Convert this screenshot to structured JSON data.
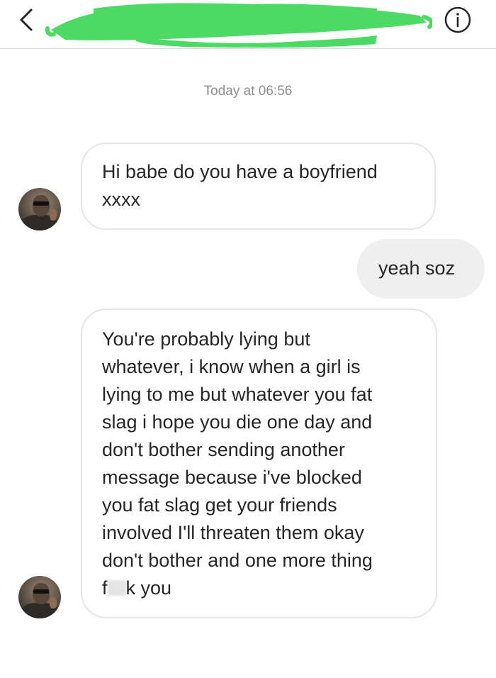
{
  "header": {
    "back_icon": "chevron-left-icon",
    "username_redacted": "green-scribble",
    "info_icon": "info-icon",
    "redaction_color": "#4cd964"
  },
  "thread": {
    "timestamp": "Today at 06:56",
    "messages": [
      {
        "direction": "incoming",
        "text": "Hi babe do you have a boyfriend\nxxxx"
      },
      {
        "direction": "outgoing",
        "text": "yeah soz"
      },
      {
        "direction": "incoming",
        "text_before_blur": "You're probably lying but\nwhatever, i know when a girl is\nlying to me but whatever you fat\nslag i hope you die one day and\ndon't bother sending another\nmessage because i've blocked\nyou fat slag get your friends\ninvolved I'll threaten them okay\ndon't bother and one more thing\nf",
        "text_after_blur": "k you"
      }
    ]
  },
  "colors": {
    "incoming_border": "#e6e6e6",
    "outgoing_bg": "#efefef",
    "timestamp": "#8e8e8e"
  }
}
